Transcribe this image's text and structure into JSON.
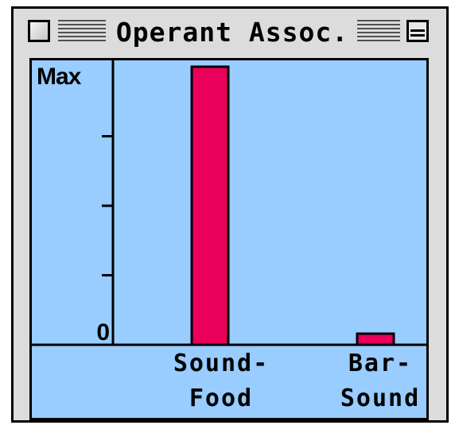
{
  "window": {
    "title": "Operant Assoc."
  },
  "chart_data": {
    "type": "bar",
    "categories": [
      "Sound-\nFood",
      "Bar-\nSound"
    ],
    "category_lines": [
      [
        "Sound-",
        "Food"
      ],
      [
        "Bar-",
        "Sound"
      ]
    ],
    "values": [
      1.0,
      0.04
    ],
    "y_tick_labels": {
      "max": "Max",
      "zero": "0"
    },
    "ylim": [
      0,
      1
    ],
    "minor_ticks": 3,
    "grid": false,
    "colors": {
      "bar_fill": "#e8005a",
      "bar_stroke": "#000000",
      "background": "#99ccff",
      "axis": "#000000"
    }
  }
}
